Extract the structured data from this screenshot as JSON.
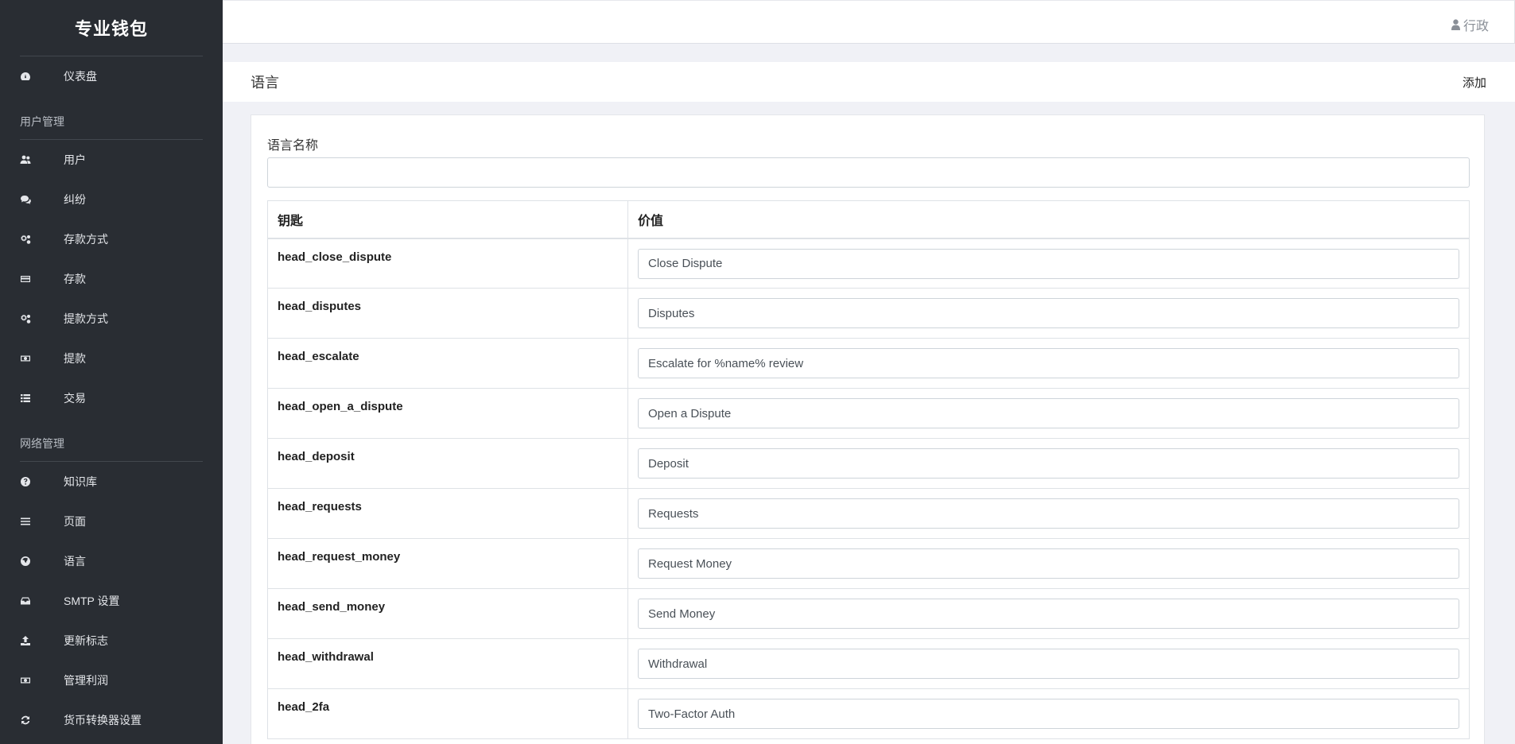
{
  "app": {
    "brand": "专业钱包"
  },
  "sidebar": {
    "top_items": [
      {
        "label": "仪表盘",
        "icon": "dashboard-icon"
      }
    ],
    "sections": [
      {
        "title": "用户管理",
        "items": [
          {
            "label": "用户",
            "icon": "users-icon"
          },
          {
            "label": "纠纷",
            "icon": "comments-icon"
          },
          {
            "label": "存款方式",
            "icon": "cogs-icon"
          },
          {
            "label": "存款",
            "icon": "credit-card-icon"
          },
          {
            "label": "提款方式",
            "icon": "cogs-icon"
          },
          {
            "label": "提款",
            "icon": "money-icon"
          },
          {
            "label": "交易",
            "icon": "list-icon"
          }
        ]
      },
      {
        "title": "网络管理",
        "items": [
          {
            "label": "知识库",
            "icon": "question-circle-icon"
          },
          {
            "label": "页面",
            "icon": "bars-icon"
          },
          {
            "label": "语言",
            "icon": "globe-icon"
          },
          {
            "label": "SMTP 设置",
            "icon": "inbox-icon"
          },
          {
            "label": "更新标志",
            "icon": "upload-icon"
          },
          {
            "label": "管理利润",
            "icon": "money-icon"
          },
          {
            "label": "货币转换器设置",
            "icon": "refresh-icon"
          }
        ]
      }
    ]
  },
  "topbar": {
    "user_label": "行政"
  },
  "page": {
    "title": "语言",
    "add_label": "添加"
  },
  "form": {
    "name_label": "语言名称",
    "name_value": "",
    "table": {
      "headers": {
        "key": "钥匙",
        "value": "价值"
      },
      "rows": [
        {
          "key": "head_close_dispute",
          "value": "Close Dispute"
        },
        {
          "key": "head_disputes",
          "value": "Disputes"
        },
        {
          "key": "head_escalate",
          "value": "Escalate for %name% review"
        },
        {
          "key": "head_open_a_dispute",
          "value": "Open a Dispute"
        },
        {
          "key": "head_deposit",
          "value": "Deposit"
        },
        {
          "key": "head_requests",
          "value": "Requests"
        },
        {
          "key": "head_request_money",
          "value": "Request Money"
        },
        {
          "key": "head_send_money",
          "value": "Send Money"
        },
        {
          "key": "head_withdrawal",
          "value": "Withdrawal"
        },
        {
          "key": "head_2fa",
          "value": "Two-Factor Auth"
        }
      ]
    }
  }
}
